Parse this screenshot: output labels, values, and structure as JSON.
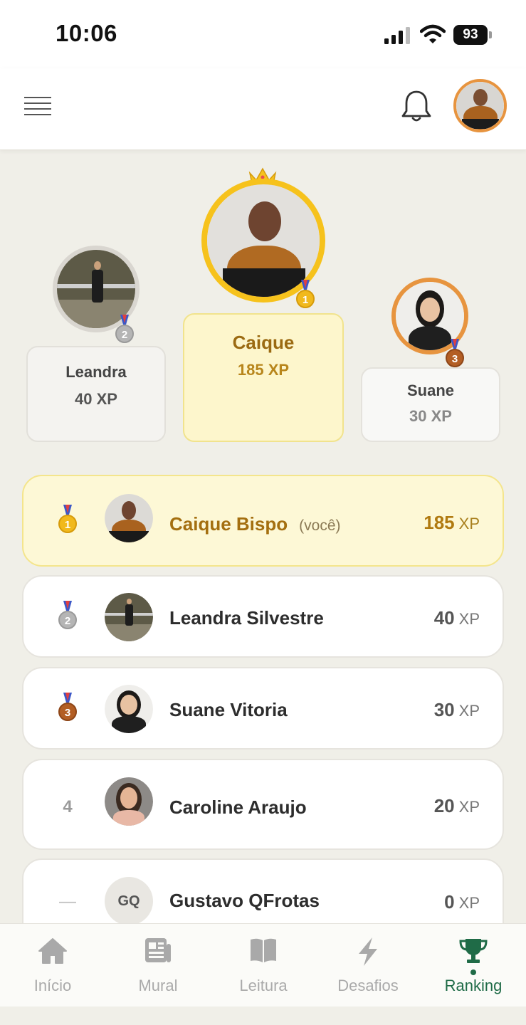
{
  "status_bar": {
    "time": "10:06",
    "battery": "93"
  },
  "header": {
    "menu_icon": "hamburger-icon",
    "notifications_icon": "bell-icon",
    "profile_avatar": "user-avatar"
  },
  "podium": [
    {
      "place": 2,
      "name": "Leandra",
      "xp": "40 XP",
      "medal": "2"
    },
    {
      "place": 1,
      "name": "Caique",
      "xp": "185 XP",
      "medal": "1"
    },
    {
      "place": 3,
      "name": "Suane",
      "xp": "30 XP",
      "medal": "3"
    }
  ],
  "ranking": [
    {
      "rank": "1",
      "name": "Caique Bispo",
      "you_label": "(você)",
      "xp": "185",
      "unit": "XP"
    },
    {
      "rank": "2",
      "name": "Leandra Silvestre",
      "xp": "40",
      "unit": "XP"
    },
    {
      "rank": "3",
      "name": "Suane Vitoria",
      "xp": "30",
      "unit": "XP"
    },
    {
      "rank": "4",
      "name": "Caroline Araujo",
      "xp": "20",
      "unit": "XP"
    },
    {
      "rank": "—",
      "name": "Gustavo QFrotas",
      "initials": "GQ",
      "xp": "0",
      "unit": "XP"
    }
  ],
  "nav": [
    {
      "label": "Início",
      "icon": "home-icon"
    },
    {
      "label": "Mural",
      "icon": "newspaper-icon"
    },
    {
      "label": "Leitura",
      "icon": "book-icon"
    },
    {
      "label": "Desafios",
      "icon": "lightning-icon"
    },
    {
      "label": "Ranking",
      "icon": "trophy-icon",
      "active": true
    }
  ],
  "colors": {
    "gold": "#f6c21c",
    "silver": "#b5b5b5",
    "bronze": "#b35e24",
    "active_nav": "#1f6b47",
    "accent_orange": "#e7943f"
  }
}
